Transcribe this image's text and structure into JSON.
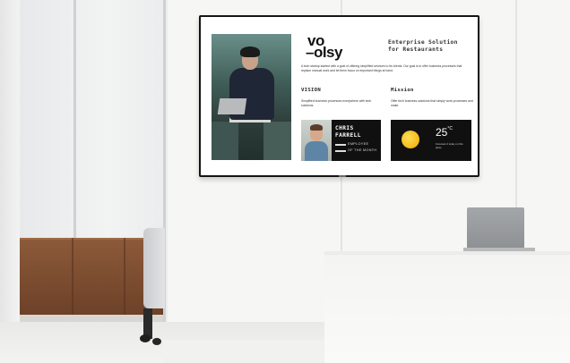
{
  "signage": {
    "logo_line1": "vo",
    "logo_line2": "–olsy",
    "headline_line1": "Enterprise Solution",
    "headline_line2": "for Restaurants",
    "intro": "A tech startup started with a goal of offering simplified services to its clients. Our goal is to offer business processes that replace manual work and let them focus on important things at hand.",
    "vision": {
      "title": "VISION",
      "body": "Simplified business processes everywhere with tech solutions."
    },
    "mission": {
      "title": "Mission",
      "body": "Offer tech business solutions that simply work processes and make."
    },
    "employee_card": {
      "first_name": "CHRIS",
      "last_name": "FARRELL",
      "badge_line1": "EMPLOYEE",
      "badge_line2": "OF THE MONTH"
    },
    "weather": {
      "temperature": "25",
      "unit": "°C",
      "note": "Forecast of today on this place"
    }
  }
}
